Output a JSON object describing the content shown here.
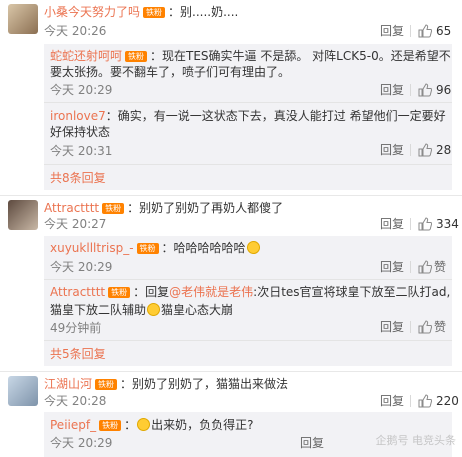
{
  "ui": {
    "reply_label": "回复",
    "zan_label": "赞"
  },
  "c1": {
    "user": "小桑今天努力了吗",
    "badge": "铁粉",
    "text": "：别.....奶....",
    "time": "今天 20:26",
    "likes": "65"
  },
  "c1r1": {
    "user": "蛇蛇还射呵呵",
    "badge": "铁粉",
    "text1": "：现在TES确实牛逼 不是舔。 对阵LCK5-0。还是希望不",
    "text2": "要太张扬。要不翻车了，喷子们可有理由了。",
    "time": "今天 20:29",
    "likes": "96"
  },
  "c1r2": {
    "user": "ironlove7",
    "text1": "：确实，有一说一这状态下去，真没人能打过 希望他们一定要好",
    "text2": "好保持状态",
    "time": "今天 20:31",
    "likes": "28"
  },
  "c1more": "共8条回复",
  "c2": {
    "user": "Attractttt",
    "badge": "铁粉",
    "text": "：别奶了别奶了再奶人都傻了",
    "time": "今天 20:27",
    "likes": "334"
  },
  "c2r1": {
    "user": "xuyukllltrisp_-",
    "badge": "铁粉",
    "text": "：哈哈哈哈哈哈",
    "time": "今天 20:29"
  },
  "c2r2": {
    "user": "Attractttt",
    "badge": "铁粉",
    "text1a": "：回复",
    "mention": "@老伟就是老伟",
    "text1b": ":次日tes官宣将球皇下放至二队打ad,",
    "text2a": "猫皇下放二队辅助",
    "text2b": "猫皇心态大崩",
    "time": "49分钟前"
  },
  "c2more": "共5条回复",
  "c3": {
    "user": "江湖山河",
    "badge": "铁粉",
    "text": "：别奶了别奶了，猫猫出来做法",
    "time": "今天 20:28",
    "likes": "220"
  },
  "c3r1": {
    "user": "Peiiepf_",
    "badge": "铁粉",
    "text": "出来奶，负负得正?",
    "time": "今天 20:29"
  },
  "watermark": "企鹅号 电竞头条"
}
